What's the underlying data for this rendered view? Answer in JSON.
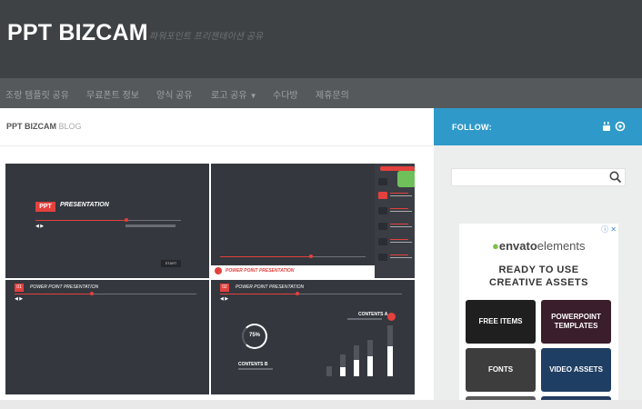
{
  "header": {
    "site_title": "PPT BIZCAM",
    "tagline": "파워포인트 프리젠테이션 공유"
  },
  "nav": {
    "items": [
      {
        "label": "조랑 템플릿 공유"
      },
      {
        "label": "무료폰트 정보"
      },
      {
        "label": "양식 공유"
      },
      {
        "label": "로고 공유",
        "has_dropdown": true
      },
      {
        "label": "수다방"
      },
      {
        "label": "제휴문의"
      }
    ],
    "caret": "▼"
  },
  "main": {
    "breadcrumb_site": "PPT BIZCAM",
    "breadcrumb_section": "BLOG",
    "preview": {
      "slide1": {
        "badge": "PPT",
        "title": "PRESENTATION",
        "controls": "◀ ▶",
        "start_label": "START"
      },
      "slide2": {
        "footer_title": "POWER POINT PRESENTATION"
      },
      "slide3": {
        "badge": "01",
        "title": "POWER POINT PRESENTATION",
        "controls": "◀ ▶"
      },
      "slide4": {
        "badge": "02",
        "title": "POWER POINT PRESENTATION",
        "controls": "◀ ▶",
        "ring_value": "75%",
        "content_a": "CONTENTS A",
        "content_b": "CONTENTS B"
      }
    }
  },
  "sidebar": {
    "follow_label": "FOLLOW:",
    "follow_icons": [
      "youtube-icon",
      "rss-icon"
    ],
    "search": {
      "placeholder": ""
    },
    "ad": {
      "logo_text": "envato",
      "logo_suffix": "elements",
      "headline_line1": "READY TO USE",
      "headline_line2": "CREATIVE ASSETS",
      "tiles": [
        {
          "label": "FREE ITEMS"
        },
        {
          "label": "POWERPOINT TEMPLATES"
        },
        {
          "label": "FONTS"
        },
        {
          "label": "VIDEO ASSETS"
        }
      ]
    }
  },
  "colors": {
    "header_bg": "#3f4244",
    "nav_bg": "#56595c",
    "follow_bg": "#2f9ac9",
    "accent_red": "#e3413d",
    "slide_bg": "#34373e"
  }
}
